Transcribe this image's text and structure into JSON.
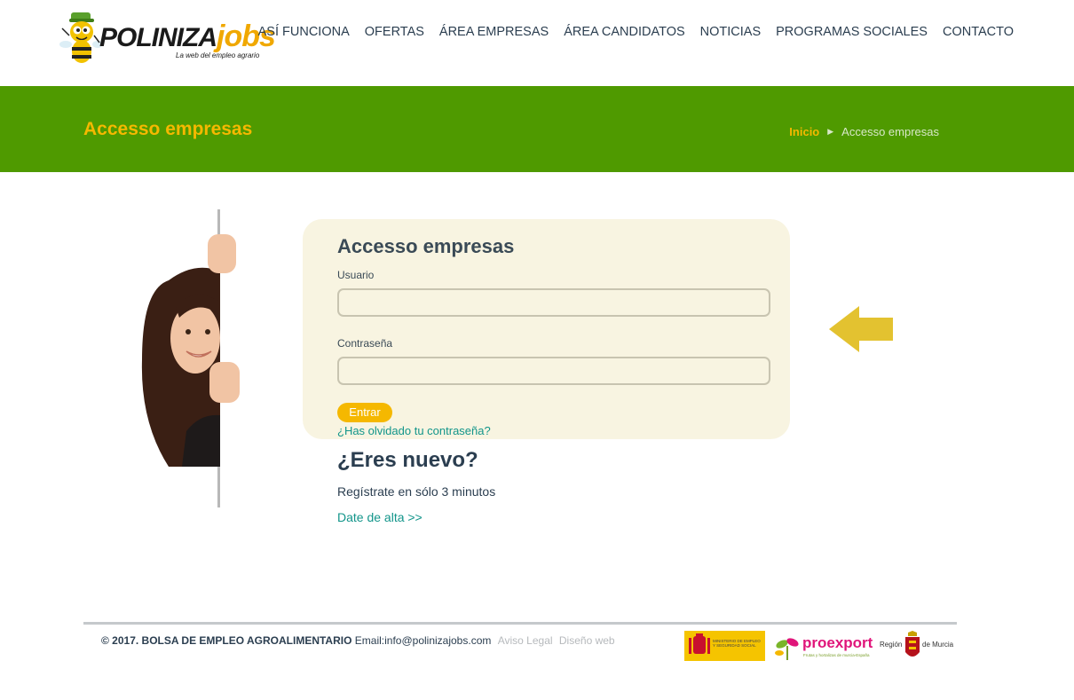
{
  "header": {
    "logo_word1": "POLINIZA",
    "logo_word2": "jobs",
    "logo_tagline": "La web del empleo agrario",
    "nav": [
      "ASÍ FUNCIONA",
      "OFERTAS",
      "ÁREA EMPRESAS",
      "ÁREA CANDIDATOS",
      "NOTICIAS",
      "PROGRAMAS SOCIALES",
      "CONTACTO"
    ]
  },
  "banner": {
    "title": "Accesso empresas",
    "breadcrumb_home": "Inicio",
    "breadcrumb_current": "Accesso empresas"
  },
  "login": {
    "title": "Accesso empresas",
    "user_label": "Usuario",
    "user_value": "",
    "password_label": "Contraseña",
    "password_value": "",
    "submit_label": "Entrar",
    "forgot_link": "¿Has olvidado tu contraseña?"
  },
  "new_user": {
    "title": "¿Eres nuevo?",
    "text": "Regístrate en sólo 3 minutos",
    "link": "Date de alta >>"
  },
  "footer": {
    "copyright": "© 2017. BOLSA DE EMPLEO AGROALIMENTARIO",
    "email": "Email:info@polinizajobs.com",
    "legal_link": "Aviso Legal",
    "design_link": "Diseño web",
    "ministerio_text": "MINISTERIO DE EMPLEO Y SEGURIDAD SOCIAL",
    "proexport_name": "proexport",
    "proexport_sub": "Frutas y hortalizas de murcia-España",
    "murcia_left": "Región",
    "murcia_right": "de Murcia"
  },
  "colors": {
    "banner_green": "#4f9a00",
    "accent_yellow": "#f5b800",
    "link_teal": "#12958a",
    "card_bg": "#f8f4e1"
  }
}
